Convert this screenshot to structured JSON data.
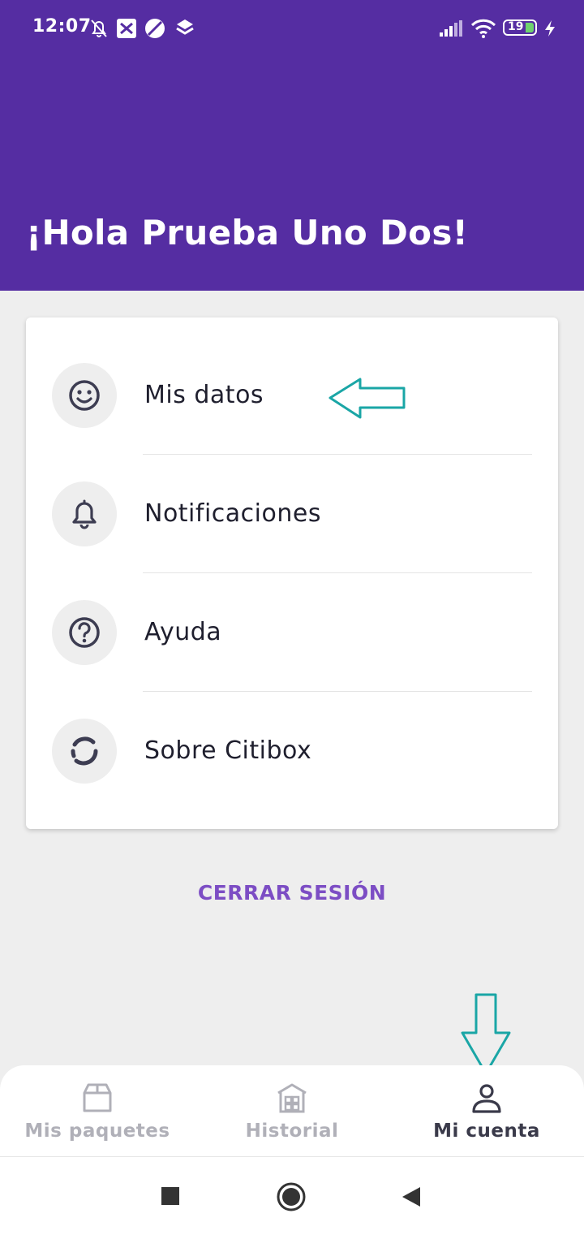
{
  "status_bar": {
    "time": "12:07",
    "battery": "19"
  },
  "header": {
    "greeting": "¡Hola Prueba Uno Dos!"
  },
  "menu": {
    "items": [
      {
        "label": "Mis datos",
        "icon": "smiley-icon"
      },
      {
        "label": "Notificaciones",
        "icon": "bell-icon"
      },
      {
        "label": "Ayuda",
        "icon": "question-icon"
      },
      {
        "label": "Sobre Citibox",
        "icon": "citibox-logo-icon"
      }
    ]
  },
  "logout_label": "CERRAR SESIÓN",
  "bottom_nav": {
    "items": [
      {
        "label": "Mis paquetes",
        "icon": "package-icon",
        "active": false
      },
      {
        "label": "Historial",
        "icon": "warehouse-icon",
        "active": false
      },
      {
        "label": "Mi cuenta",
        "icon": "user-icon",
        "active": true
      }
    ]
  },
  "colors": {
    "header_bg": "#552da2",
    "accent": "#7c4dc4",
    "annotation_arrow": "#1aa6a6"
  }
}
